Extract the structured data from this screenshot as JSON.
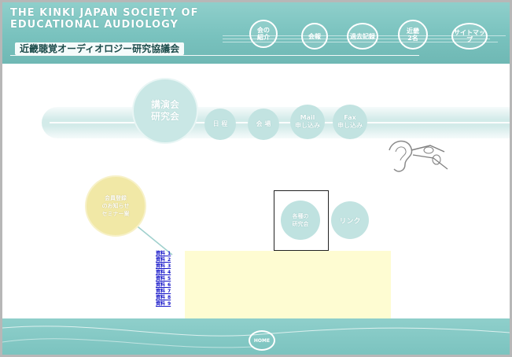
{
  "header": {
    "title_en": "THE KINKI JAPAN SOCIETY OF EDUCATIONAL AUDIOLOGY",
    "title_jp": "近畿聴覚オーディオロジー研究協議会",
    "nav": [
      {
        "label": "会の\n紹介"
      },
      {
        "label": "会報"
      },
      {
        "label": "過去記録"
      },
      {
        "label": "近畿\n2名"
      },
      {
        "label": "サイトマップ"
      }
    ]
  },
  "main": {
    "big_circle_label": "講演会\n研究会",
    "sub_buttons": [
      {
        "label": "日 程"
      },
      {
        "label": "会 場"
      },
      {
        "label": "Mail\n申し込み"
      },
      {
        "label": "Fax\n申し込み"
      }
    ],
    "yellow_circle_label": "会員登録\nのお知らせ\nセミナー案",
    "boxed_circle_label": "各種の\n研究会",
    "center_circle_label": "リンク",
    "links": [
      "資料_1",
      "資料_2",
      "資料_3",
      "資料_4",
      "資料_5",
      "資料_6",
      "資料_7",
      "資料_8",
      "資料_9"
    ]
  },
  "footer": {
    "home_label": "HOME"
  },
  "colors": {
    "accent_teal": "#7bc3bf",
    "circle_teal": "#c2e3e1",
    "yellow": "#f1e8a6",
    "panel_yellow": "#fefcd2",
    "link_blue": "#1515c9"
  }
}
